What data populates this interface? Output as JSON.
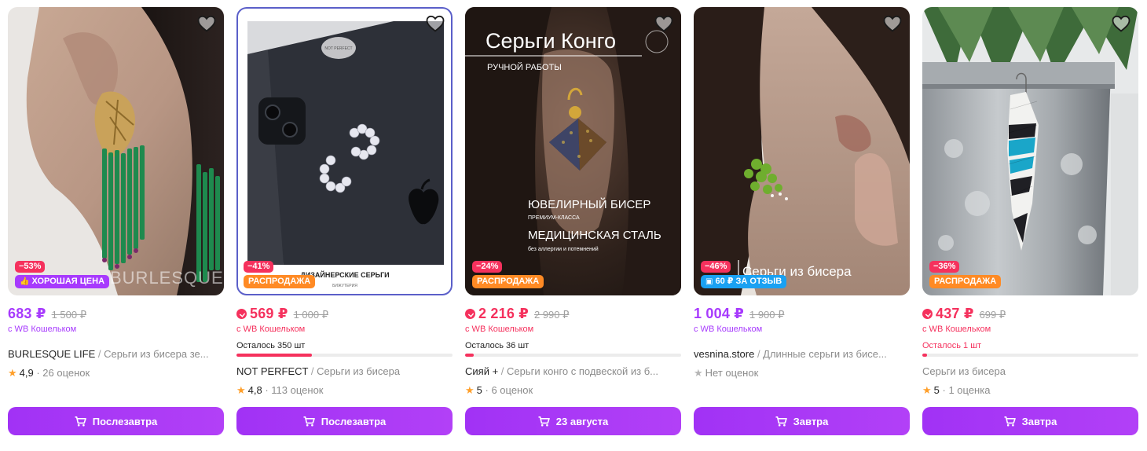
{
  "colors": {
    "accent": "#a73afd",
    "discount": "#f5315d",
    "price_purple": "#a73afd",
    "price_red": "#f5315d",
    "good_price_badge": "#a73afd",
    "sale_badge": "#ff8a24",
    "review_badge": "#1aa1f2"
  },
  "products": [
    {
      "discount": "−53%",
      "promo": {
        "label": "ХОРОШАЯ ЦЕНА",
        "icon": "thumbs-up-icon",
        "color": "#a73afd"
      },
      "overlay_text": "BURLESQUE LIFE",
      "price": "683 ₽",
      "old_price": "1 500 ₽",
      "wallet_icon": false,
      "wallet": "с WB Кошельком",
      "brand": "BURLESQUE LIFE",
      "name": "Серьги из бисера зе...",
      "stock": null,
      "rating": "4,9",
      "reviews": "26 оценок",
      "delivery": "Послезавтра"
    },
    {
      "discount": "−41%",
      "promo": {
        "label": "РАСПРОДАЖА",
        "icon": "",
        "color": "#ff8a24"
      },
      "overlay_text": "ДИЗАЙНЕРСКИЕ СЕРЬГИ",
      "overlay_subtext": "БИЖУТЕРИЯ",
      "overlay_logo": "NOT PERFECT",
      "price": "569 ₽",
      "old_price": "1 000 ₽",
      "wallet_icon": true,
      "wallet": "с WB Кошельком",
      "brand": "NOT PERFECT",
      "name": "Серьги из бисера",
      "stock": {
        "label": "Осталось 350 шт",
        "fill": 0.35
      },
      "rating": "4,8",
      "reviews": "113 оценок",
      "delivery": "Послезавтра"
    },
    {
      "discount": "−24%",
      "promo": {
        "label": "РАСПРОДАЖА",
        "icon": "",
        "color": "#ff8a24"
      },
      "overlay_title": "Серьги Конго",
      "overlay_sub": "РУЧНОЙ РАБОТЫ",
      "overlay_line1": "ЮВЕЛИРНЫЙ БИСЕР",
      "overlay_line1b": "ПРЕМИУМ-КЛАССА",
      "overlay_line2": "МЕДИЦИНСКАЯ СТАЛЬ",
      "overlay_line2b": "без аллергии и потемнений",
      "price": "2 216 ₽",
      "old_price": "2 990 ₽",
      "wallet_icon": true,
      "wallet": "с WB Кошельком",
      "brand": "Сияй +",
      "name": "Серьги конго с подвеской из б...",
      "stock": {
        "label": "Осталось 36 шт",
        "fill": 0.036
      },
      "rating": "5",
      "reviews": "6 оценок",
      "delivery": "23 августа"
    },
    {
      "discount": "−46%",
      "promo": {
        "label": "60 ₽ ЗА ОТЗЫВ",
        "icon": "wallet-icon",
        "color": "#1aa1f2"
      },
      "overlay_text": "Серьги из бисера",
      "price": "1 004 ₽",
      "old_price": "1 900 ₽",
      "wallet_icon": false,
      "wallet": "с WB Кошельком",
      "brand": "vesnina.store",
      "name": "Длинные серьги из бисе...",
      "stock": null,
      "rating": "",
      "reviews": "Нет оценок",
      "delivery": "Завтра"
    },
    {
      "discount": "−36%",
      "promo": {
        "label": "РАСПРОДАЖА",
        "icon": "",
        "color": "#ff8a24"
      },
      "price": "437 ₽",
      "old_price": "699 ₽",
      "wallet_icon": true,
      "wallet": "с WB Кошельком",
      "brand": "",
      "name": "Серьги из бисера",
      "stock": {
        "label": "Осталось 1 шт",
        "fill": 0.004,
        "low": true
      },
      "rating": "5",
      "reviews": "1 оценка",
      "delivery": "Завтра"
    }
  ]
}
